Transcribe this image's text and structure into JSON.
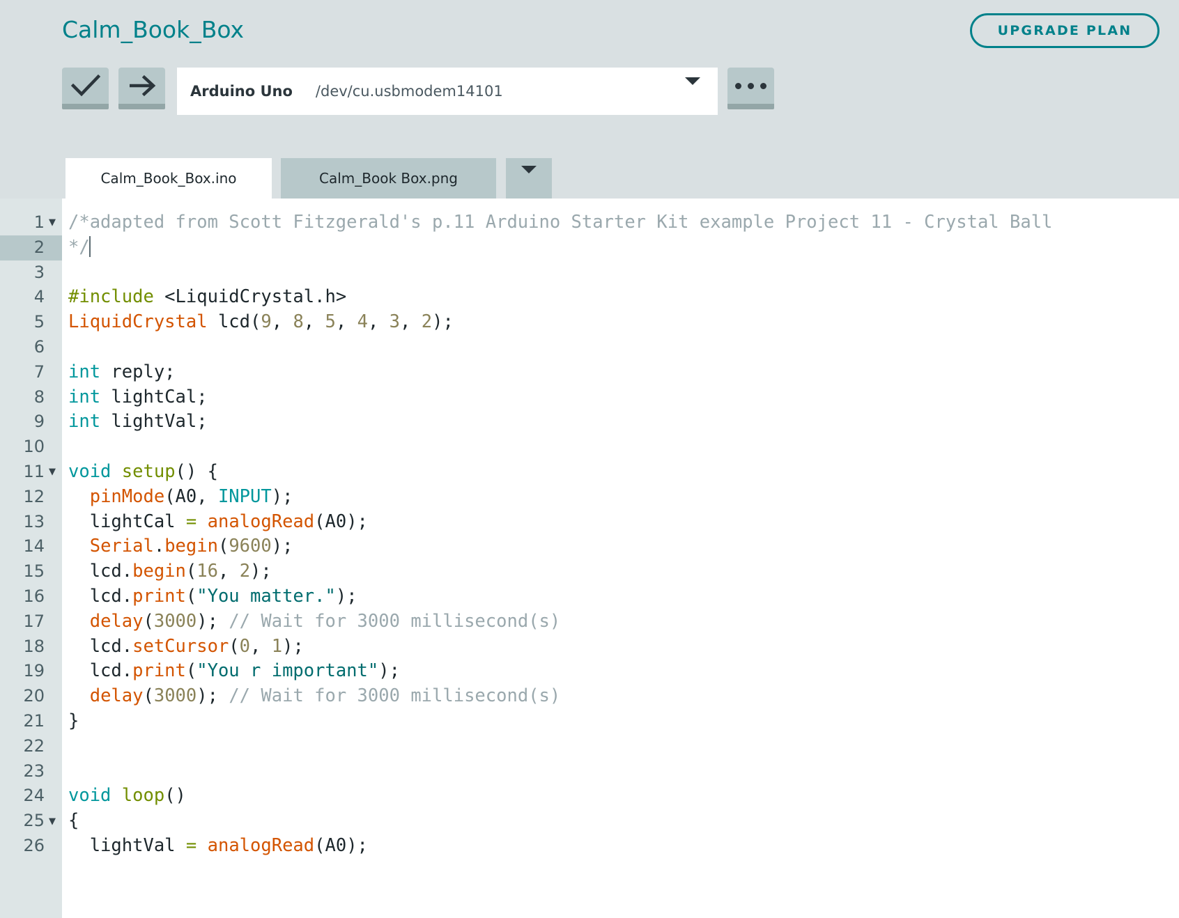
{
  "header": {
    "project_title": "Calm_Book_Box",
    "upgrade_label": "UPGRADE PLAN",
    "title_color": "#00818a"
  },
  "toolbar": {
    "verify_icon": "check-icon",
    "upload_icon": "arrow-right-icon",
    "more_icon": "ellipsis-icon",
    "board_name": "Arduino Uno",
    "board_port": "/dev/cu.usbmodem14101",
    "dropdown_icon": "chevron-down-icon"
  },
  "tabs": {
    "items": [
      {
        "label": "Calm_Book_Box.ino",
        "active": true
      },
      {
        "label": "Calm_Book Box.png",
        "active": false
      }
    ],
    "dropdown_icon": "chevron-down-icon"
  },
  "editor": {
    "active_line": 2,
    "cursor_line": 2,
    "lines": [
      {
        "n": 1,
        "fold": true,
        "tokens": [
          {
            "c": "t-com",
            "t": "/*adapted from Scott Fitzgerald's p.11 Arduino Starter Kit example Project 11 - Crystal Ball"
          }
        ]
      },
      {
        "n": 2,
        "fold": false,
        "cursor": true,
        "tokens": [
          {
            "c": "t-com",
            "t": "*/"
          }
        ]
      },
      {
        "n": 3,
        "fold": false,
        "tokens": []
      },
      {
        "n": 4,
        "fold": false,
        "tokens": [
          {
            "c": "t-pre",
            "t": "#include"
          },
          {
            "c": "t-pl",
            "t": " <LiquidCrystal.h>"
          }
        ]
      },
      {
        "n": 5,
        "fold": false,
        "tokens": [
          {
            "c": "t-type",
            "t": "LiquidCrystal"
          },
          {
            "c": "t-pl",
            "t": " lcd("
          },
          {
            "c": "t-num",
            "t": "9"
          },
          {
            "c": "t-pl",
            "t": ", "
          },
          {
            "c": "t-num",
            "t": "8"
          },
          {
            "c": "t-pl",
            "t": ", "
          },
          {
            "c": "t-num",
            "t": "5"
          },
          {
            "c": "t-pl",
            "t": ", "
          },
          {
            "c": "t-num",
            "t": "4"
          },
          {
            "c": "t-pl",
            "t": ", "
          },
          {
            "c": "t-num",
            "t": "3"
          },
          {
            "c": "t-pl",
            "t": ", "
          },
          {
            "c": "t-num",
            "t": "2"
          },
          {
            "c": "t-pl",
            "t": ");"
          }
        ]
      },
      {
        "n": 6,
        "fold": false,
        "tokens": []
      },
      {
        "n": 7,
        "fold": false,
        "tokens": [
          {
            "c": "t-kw",
            "t": "int"
          },
          {
            "c": "t-pl",
            "t": " reply;"
          }
        ]
      },
      {
        "n": 8,
        "fold": false,
        "tokens": [
          {
            "c": "t-kw",
            "t": "int"
          },
          {
            "c": "t-pl",
            "t": " lightCal;"
          }
        ]
      },
      {
        "n": 9,
        "fold": false,
        "tokens": [
          {
            "c": "t-kw",
            "t": "int"
          },
          {
            "c": "t-pl",
            "t": " lightVal;"
          }
        ]
      },
      {
        "n": 10,
        "fold": false,
        "tokens": []
      },
      {
        "n": 11,
        "fold": true,
        "tokens": [
          {
            "c": "t-kw",
            "t": "void"
          },
          {
            "c": "t-pl",
            "t": " "
          },
          {
            "c": "t-fn",
            "t": "setup"
          },
          {
            "c": "t-pl",
            "t": "() {"
          }
        ]
      },
      {
        "n": 12,
        "fold": false,
        "tokens": [
          {
            "c": "t-pl",
            "t": "  "
          },
          {
            "c": "t-call",
            "t": "pinMode"
          },
          {
            "c": "t-pl",
            "t": "(A0, "
          },
          {
            "c": "t-kw",
            "t": "INPUT"
          },
          {
            "c": "t-pl",
            "t": ");"
          }
        ]
      },
      {
        "n": 13,
        "fold": false,
        "tokens": [
          {
            "c": "t-pl",
            "t": "  lightCal "
          },
          {
            "c": "t-op",
            "t": "="
          },
          {
            "c": "t-pl",
            "t": " "
          },
          {
            "c": "t-call",
            "t": "analogRead"
          },
          {
            "c": "t-pl",
            "t": "(A0);"
          }
        ]
      },
      {
        "n": 14,
        "fold": false,
        "tokens": [
          {
            "c": "t-pl",
            "t": "  "
          },
          {
            "c": "t-call",
            "t": "Serial"
          },
          {
            "c": "t-pl",
            "t": "."
          },
          {
            "c": "t-call",
            "t": "begin"
          },
          {
            "c": "t-pl",
            "t": "("
          },
          {
            "c": "t-num",
            "t": "9600"
          },
          {
            "c": "t-pl",
            "t": ");"
          }
        ]
      },
      {
        "n": 15,
        "fold": false,
        "tokens": [
          {
            "c": "t-pl",
            "t": "  lcd."
          },
          {
            "c": "t-call",
            "t": "begin"
          },
          {
            "c": "t-pl",
            "t": "("
          },
          {
            "c": "t-num",
            "t": "16"
          },
          {
            "c": "t-pl",
            "t": ", "
          },
          {
            "c": "t-num",
            "t": "2"
          },
          {
            "c": "t-pl",
            "t": ");"
          }
        ]
      },
      {
        "n": 16,
        "fold": false,
        "tokens": [
          {
            "c": "t-pl",
            "t": "  lcd."
          },
          {
            "c": "t-call",
            "t": "print"
          },
          {
            "c": "t-pl",
            "t": "("
          },
          {
            "c": "t-str",
            "t": "\"You matter.\""
          },
          {
            "c": "t-pl",
            "t": ");"
          }
        ]
      },
      {
        "n": 17,
        "fold": false,
        "tokens": [
          {
            "c": "t-pl",
            "t": "  "
          },
          {
            "c": "t-call",
            "t": "delay"
          },
          {
            "c": "t-pl",
            "t": "("
          },
          {
            "c": "t-num",
            "t": "3000"
          },
          {
            "c": "t-pl",
            "t": "); "
          },
          {
            "c": "t-com",
            "t": "// Wait for 3000 millisecond(s)"
          }
        ]
      },
      {
        "n": 18,
        "fold": false,
        "tokens": [
          {
            "c": "t-pl",
            "t": "  lcd."
          },
          {
            "c": "t-call",
            "t": "setCursor"
          },
          {
            "c": "t-pl",
            "t": "("
          },
          {
            "c": "t-num",
            "t": "0"
          },
          {
            "c": "t-pl",
            "t": ", "
          },
          {
            "c": "t-num",
            "t": "1"
          },
          {
            "c": "t-pl",
            "t": ");"
          }
        ]
      },
      {
        "n": 19,
        "fold": false,
        "tokens": [
          {
            "c": "t-pl",
            "t": "  lcd."
          },
          {
            "c": "t-call",
            "t": "print"
          },
          {
            "c": "t-pl",
            "t": "("
          },
          {
            "c": "t-str",
            "t": "\"You r important\""
          },
          {
            "c": "t-pl",
            "t": ");"
          }
        ]
      },
      {
        "n": 20,
        "fold": false,
        "tokens": [
          {
            "c": "t-pl",
            "t": "  "
          },
          {
            "c": "t-call",
            "t": "delay"
          },
          {
            "c": "t-pl",
            "t": "("
          },
          {
            "c": "t-num",
            "t": "3000"
          },
          {
            "c": "t-pl",
            "t": "); "
          },
          {
            "c": "t-com",
            "t": "// Wait for 3000 millisecond(s)"
          }
        ]
      },
      {
        "n": 21,
        "fold": false,
        "tokens": [
          {
            "c": "t-pl",
            "t": "}"
          }
        ]
      },
      {
        "n": 22,
        "fold": false,
        "tokens": []
      },
      {
        "n": 23,
        "fold": false,
        "tokens": []
      },
      {
        "n": 24,
        "fold": false,
        "tokens": [
          {
            "c": "t-kw",
            "t": "void"
          },
          {
            "c": "t-pl",
            "t": " "
          },
          {
            "c": "t-fn",
            "t": "loop"
          },
          {
            "c": "t-pl",
            "t": "()"
          }
        ]
      },
      {
        "n": 25,
        "fold": true,
        "tokens": [
          {
            "c": "t-pl",
            "t": "{"
          }
        ]
      },
      {
        "n": 26,
        "fold": false,
        "tokens": [
          {
            "c": "t-pl",
            "t": "  lightVal "
          },
          {
            "c": "t-op",
            "t": "="
          },
          {
            "c": "t-pl",
            "t": " "
          },
          {
            "c": "t-call",
            "t": "analogRead"
          },
          {
            "c": "t-pl",
            "t": "(A0);"
          }
        ]
      }
    ]
  },
  "colors": {
    "page_bg": "#d9e0e2",
    "accent_teal": "#00818a",
    "button_face": "#b7c8ca",
    "button_shadow": "#93a6a7",
    "gutter_bg": "#dde5e6",
    "active_line_gutter": "#b7c8ca",
    "comment": "#9aa8ad",
    "preprocessor": "#728e00",
    "type": "#d35400",
    "keyword": "#00979c",
    "function": "#728e00",
    "number": "#8a8258",
    "string": "#006c6e"
  }
}
